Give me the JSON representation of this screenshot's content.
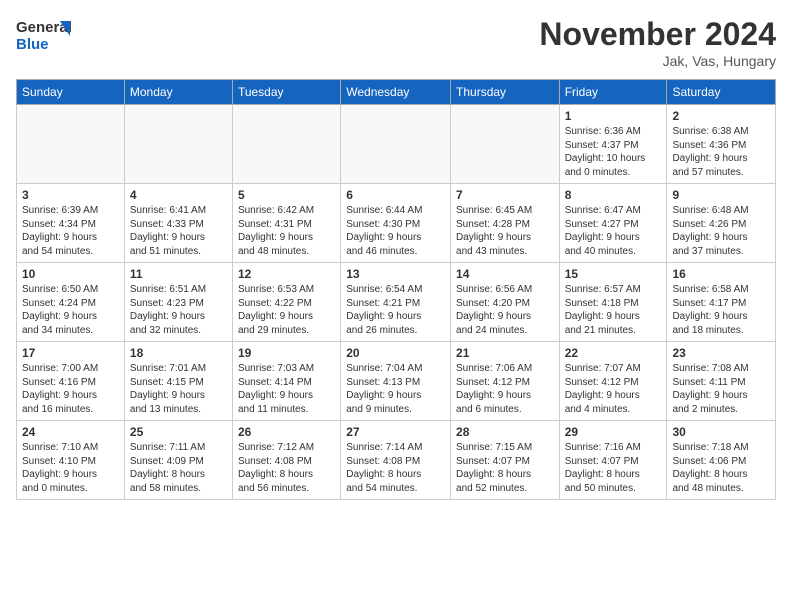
{
  "logo": {
    "line1": "General",
    "line2": "Blue"
  },
  "title": "November 2024",
  "location": "Jak, Vas, Hungary",
  "days_of_week": [
    "Sunday",
    "Monday",
    "Tuesday",
    "Wednesday",
    "Thursday",
    "Friday",
    "Saturday"
  ],
  "weeks": [
    [
      {
        "day": "",
        "info": ""
      },
      {
        "day": "",
        "info": ""
      },
      {
        "day": "",
        "info": ""
      },
      {
        "day": "",
        "info": ""
      },
      {
        "day": "",
        "info": ""
      },
      {
        "day": "1",
        "info": "Sunrise: 6:36 AM\nSunset: 4:37 PM\nDaylight: 10 hours\nand 0 minutes."
      },
      {
        "day": "2",
        "info": "Sunrise: 6:38 AM\nSunset: 4:36 PM\nDaylight: 9 hours\nand 57 minutes."
      }
    ],
    [
      {
        "day": "3",
        "info": "Sunrise: 6:39 AM\nSunset: 4:34 PM\nDaylight: 9 hours\nand 54 minutes."
      },
      {
        "day": "4",
        "info": "Sunrise: 6:41 AM\nSunset: 4:33 PM\nDaylight: 9 hours\nand 51 minutes."
      },
      {
        "day": "5",
        "info": "Sunrise: 6:42 AM\nSunset: 4:31 PM\nDaylight: 9 hours\nand 48 minutes."
      },
      {
        "day": "6",
        "info": "Sunrise: 6:44 AM\nSunset: 4:30 PM\nDaylight: 9 hours\nand 46 minutes."
      },
      {
        "day": "7",
        "info": "Sunrise: 6:45 AM\nSunset: 4:28 PM\nDaylight: 9 hours\nand 43 minutes."
      },
      {
        "day": "8",
        "info": "Sunrise: 6:47 AM\nSunset: 4:27 PM\nDaylight: 9 hours\nand 40 minutes."
      },
      {
        "day": "9",
        "info": "Sunrise: 6:48 AM\nSunset: 4:26 PM\nDaylight: 9 hours\nand 37 minutes."
      }
    ],
    [
      {
        "day": "10",
        "info": "Sunrise: 6:50 AM\nSunset: 4:24 PM\nDaylight: 9 hours\nand 34 minutes."
      },
      {
        "day": "11",
        "info": "Sunrise: 6:51 AM\nSunset: 4:23 PM\nDaylight: 9 hours\nand 32 minutes."
      },
      {
        "day": "12",
        "info": "Sunrise: 6:53 AM\nSunset: 4:22 PM\nDaylight: 9 hours\nand 29 minutes."
      },
      {
        "day": "13",
        "info": "Sunrise: 6:54 AM\nSunset: 4:21 PM\nDaylight: 9 hours\nand 26 minutes."
      },
      {
        "day": "14",
        "info": "Sunrise: 6:56 AM\nSunset: 4:20 PM\nDaylight: 9 hours\nand 24 minutes."
      },
      {
        "day": "15",
        "info": "Sunrise: 6:57 AM\nSunset: 4:18 PM\nDaylight: 9 hours\nand 21 minutes."
      },
      {
        "day": "16",
        "info": "Sunrise: 6:58 AM\nSunset: 4:17 PM\nDaylight: 9 hours\nand 18 minutes."
      }
    ],
    [
      {
        "day": "17",
        "info": "Sunrise: 7:00 AM\nSunset: 4:16 PM\nDaylight: 9 hours\nand 16 minutes."
      },
      {
        "day": "18",
        "info": "Sunrise: 7:01 AM\nSunset: 4:15 PM\nDaylight: 9 hours\nand 13 minutes."
      },
      {
        "day": "19",
        "info": "Sunrise: 7:03 AM\nSunset: 4:14 PM\nDaylight: 9 hours\nand 11 minutes."
      },
      {
        "day": "20",
        "info": "Sunrise: 7:04 AM\nSunset: 4:13 PM\nDaylight: 9 hours\nand 9 minutes."
      },
      {
        "day": "21",
        "info": "Sunrise: 7:06 AM\nSunset: 4:12 PM\nDaylight: 9 hours\nand 6 minutes."
      },
      {
        "day": "22",
        "info": "Sunrise: 7:07 AM\nSunset: 4:12 PM\nDaylight: 9 hours\nand 4 minutes."
      },
      {
        "day": "23",
        "info": "Sunrise: 7:08 AM\nSunset: 4:11 PM\nDaylight: 9 hours\nand 2 minutes."
      }
    ],
    [
      {
        "day": "24",
        "info": "Sunrise: 7:10 AM\nSunset: 4:10 PM\nDaylight: 9 hours\nand 0 minutes."
      },
      {
        "day": "25",
        "info": "Sunrise: 7:11 AM\nSunset: 4:09 PM\nDaylight: 8 hours\nand 58 minutes."
      },
      {
        "day": "26",
        "info": "Sunrise: 7:12 AM\nSunset: 4:08 PM\nDaylight: 8 hours\nand 56 minutes."
      },
      {
        "day": "27",
        "info": "Sunrise: 7:14 AM\nSunset: 4:08 PM\nDaylight: 8 hours\nand 54 minutes."
      },
      {
        "day": "28",
        "info": "Sunrise: 7:15 AM\nSunset: 4:07 PM\nDaylight: 8 hours\nand 52 minutes."
      },
      {
        "day": "29",
        "info": "Sunrise: 7:16 AM\nSunset: 4:07 PM\nDaylight: 8 hours\nand 50 minutes."
      },
      {
        "day": "30",
        "info": "Sunrise: 7:18 AM\nSunset: 4:06 PM\nDaylight: 8 hours\nand 48 minutes."
      }
    ]
  ]
}
